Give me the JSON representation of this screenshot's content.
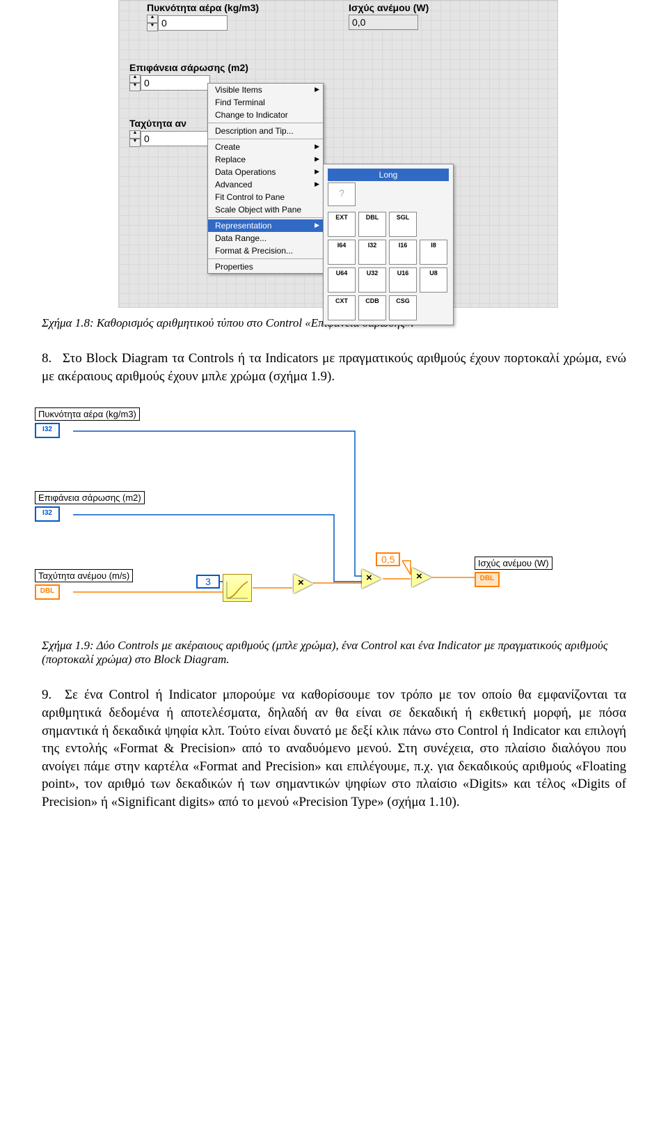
{
  "front_panel": {
    "controls": [
      {
        "label": "Πυκνότητα αέρα (kg/m3)",
        "value": "0"
      },
      {
        "label": "Ισχύς ανέμου (W)",
        "value": "0,0"
      },
      {
        "label": "Επιφάνεια σάρωσης (m2)",
        "value": "0"
      },
      {
        "label": "Ταχύτητα αν",
        "value": "0"
      }
    ]
  },
  "context_menu": {
    "items": [
      "Visible Items",
      "Find Terminal",
      "Change to Indicator",
      "Description and Tip...",
      "Create",
      "Replace",
      "Data Operations",
      "Advanced",
      "Fit Control to Pane",
      "Scale Object with Pane",
      "Representation",
      "Data Range...",
      "Format & Precision...",
      "Properties"
    ]
  },
  "rep_palette": {
    "title": "Long",
    "cells": [
      "EXT",
      "DBL",
      "SGL",
      "",
      "I64",
      "I32",
      "I16",
      "I8",
      "U64",
      "U32",
      "U16",
      "U8",
      "CXT",
      "CDB",
      "CSG",
      ""
    ]
  },
  "caption1": "Σχήμα 1.8: Καθορισμός αριθμητικού τύπου στο Control «Επιφάνεια σάρωσης».",
  "para1_num": "8.",
  "para1": "Στο Block Diagram τα Controls ή τα Indicators με πραγματικούς αριθμούς έχουν πορτοκαλί χρώμα, ενώ με ακέραιους αριθμούς έχουν μπλε χρώμα (σχήμα 1.9).",
  "block_diagram": {
    "labels": {
      "l1": "Πυκνότητα αέρα (kg/m3)",
      "l2": "Επιφάνεια σάρωσης (m2)",
      "l3": "Ταχύτητα ανέμου (m/s)",
      "l4": "Ισχύς ανέμου (W)"
    },
    "terms": {
      "t1": "I32",
      "t2": "I32",
      "t3": "DBL",
      "t4": "DBL"
    },
    "const1": "3",
    "const2": "0,5"
  },
  "caption2": "Σχήμα 1.9: Δύο Controls με ακέραιους αριθμούς (μπλε χρώμα), ένα Control και ένα Indicator με πραγματικούς αριθμούς (πορτοκαλί χρώμα) στο Block Diagram.",
  "para2_num": "9.",
  "para2": "Σε ένα Control ή Indicator μπορούμε να καθορίσουμε τον τρόπο με τον οποίο θα εμφανίζονται τα αριθμητικά δεδομένα ή αποτελέσματα, δηλαδή αν θα είναι σε δεκαδική ή εκθετική μορφή, με πόσα σημαντικά ή δεκαδικά ψηφία κλπ. Τούτο είναι δυνατό με δεξί κλικ πάνω στο Control ή Indicator και επιλογή της εντολής «Format & Precision» από το αναδυόμενο μενού. Στη συνέχεια, στο πλαίσιο διαλόγου που ανοίγει πάμε στην καρτέλα «Format and Precision» και επιλέγουμε, π.χ. για δεκαδικούς αριθμούς «Floating point», τον αριθμό των δεκαδικών ή των σημαντικών ψηφίων στο πλαίσιο «Digits» και τέλος «Digits of Precision» ή «Significant digits» από το μενού «Precision Type» (σχήμα 1.10)."
}
